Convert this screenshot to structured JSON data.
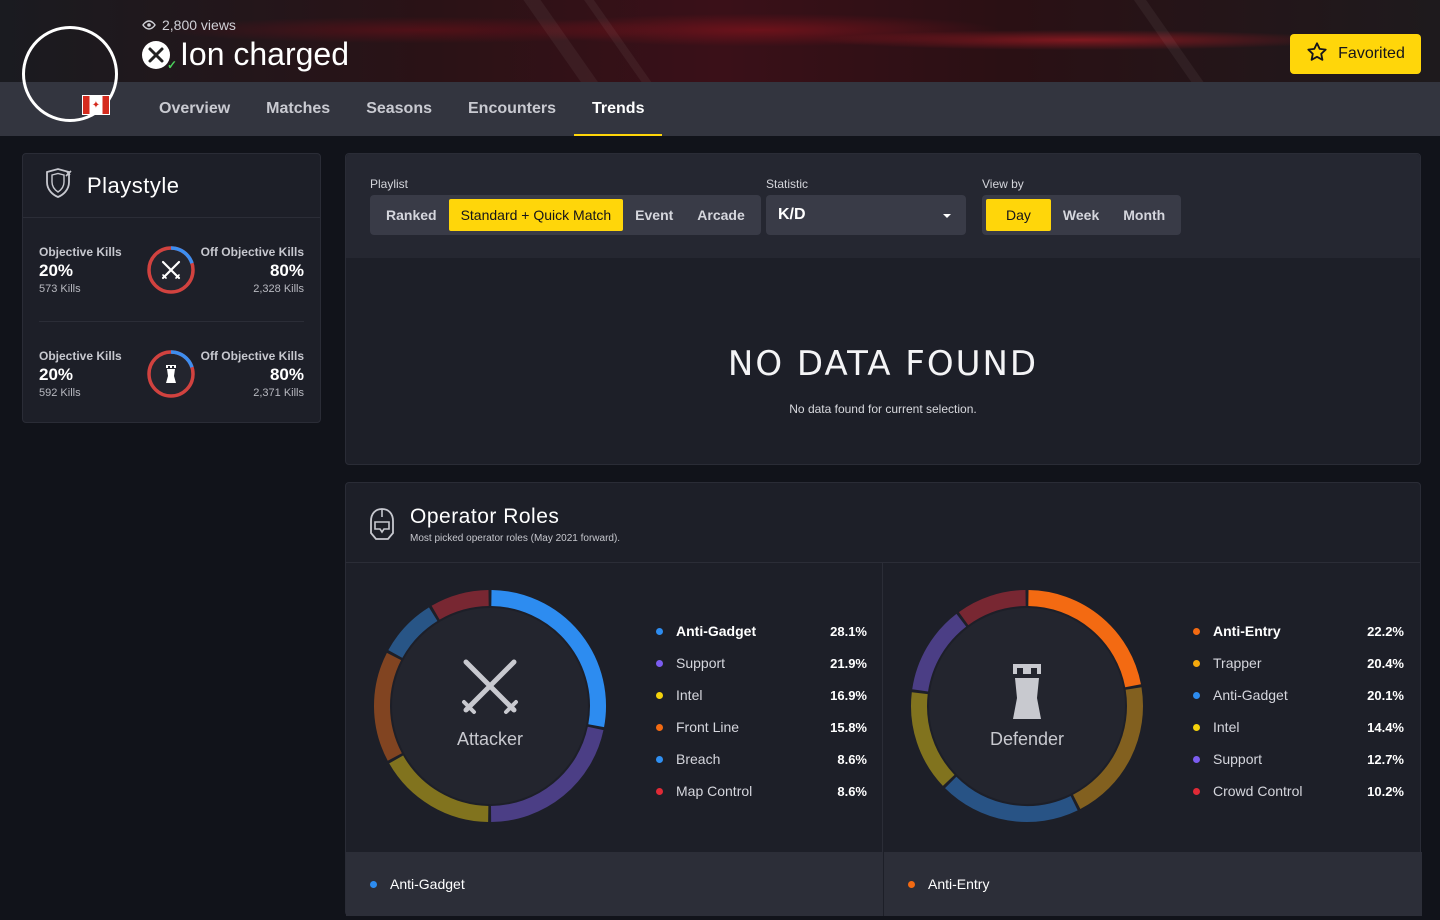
{
  "header": {
    "views": "2,800 views",
    "player_name": "Ion charged",
    "platform_icon": "xbox-icon",
    "flag_icon": "canada-flag-icon",
    "favorite_label": "Favorited",
    "accent": "#ffd60a"
  },
  "tabs": [
    {
      "label": "Overview"
    },
    {
      "label": "Matches"
    },
    {
      "label": "Seasons"
    },
    {
      "label": "Encounters"
    },
    {
      "label": "Trends",
      "active": true
    }
  ],
  "playstyle": {
    "title": "Playstyle",
    "rows": [
      {
        "left": {
          "label": "Objective Kills",
          "pct": "20%",
          "sub": "573 Kills"
        },
        "right": {
          "label": "Off Objective Kills",
          "pct": "80%",
          "sub": "2,328 Kills"
        },
        "icon": "crossed-swords-icon",
        "fraction": 0.2
      },
      {
        "left": {
          "label": "Objective Kills",
          "pct": "20%",
          "sub": "592 Kills"
        },
        "right": {
          "label": "Off Objective Kills",
          "pct": "80%",
          "sub": "2,371 Kills"
        },
        "icon": "tower-icon",
        "fraction": 0.2
      }
    ]
  },
  "trends": {
    "playlist_label": "Playlist",
    "playlist_options": [
      "Ranked",
      "Standard + Quick Match",
      "Event",
      "Arcade"
    ],
    "playlist_selected": "Standard + Quick Match",
    "statistic_label": "Statistic",
    "statistic_value": "K/D",
    "viewby_label": "View by",
    "viewby_options": [
      "Day",
      "Week",
      "Month"
    ],
    "viewby_selected": "Day",
    "nodata_title": "NO DATA FOUND",
    "nodata_sub": "No data found for current selection."
  },
  "roles": {
    "title": "Operator Roles",
    "subtitle": "Most picked operator roles (May 2021 forward).",
    "attacker": {
      "label": "Attacker",
      "icon": "crossed-swords-icon",
      "items": [
        {
          "name": "Anti-Gadget",
          "value": "28.1%",
          "pct": 28.1,
          "color": "#2d8cf0"
        },
        {
          "name": "Support",
          "value": "21.9%",
          "pct": 21.9,
          "color": "#7b5cf0"
        },
        {
          "name": "Intel",
          "value": "16.9%",
          "pct": 16.9,
          "color": "#f4d20b"
        },
        {
          "name": "Front Line",
          "value": "15.8%",
          "pct": 15.8,
          "color": "#f36a12"
        },
        {
          "name": "Breach",
          "value": "8.6%",
          "pct": 8.6,
          "color": "#2f8ff2"
        },
        {
          "name": "Map Control",
          "value": "8.6%",
          "pct": 8.6,
          "color": "#e02a36"
        }
      ],
      "footer": "Anti-Gadget"
    },
    "defender": {
      "label": "Defender",
      "icon": "tower-icon",
      "items": [
        {
          "name": "Anti-Entry",
          "value": "22.2%",
          "pct": 22.2,
          "color": "#f36a12"
        },
        {
          "name": "Trapper",
          "value": "20.4%",
          "pct": 20.4,
          "color": "#f5a90c"
        },
        {
          "name": "Anti-Gadget",
          "value": "20.1%",
          "pct": 20.1,
          "color": "#2d8cf0"
        },
        {
          "name": "Intel",
          "value": "14.4%",
          "pct": 14.4,
          "color": "#f4d20b"
        },
        {
          "name": "Support",
          "value": "12.7%",
          "pct": 12.7,
          "color": "#7b5cf0"
        },
        {
          "name": "Crowd Control",
          "value": "10.2%",
          "pct": 10.2,
          "color": "#e02a36"
        }
      ],
      "footer": "Anti-Entry"
    }
  }
}
